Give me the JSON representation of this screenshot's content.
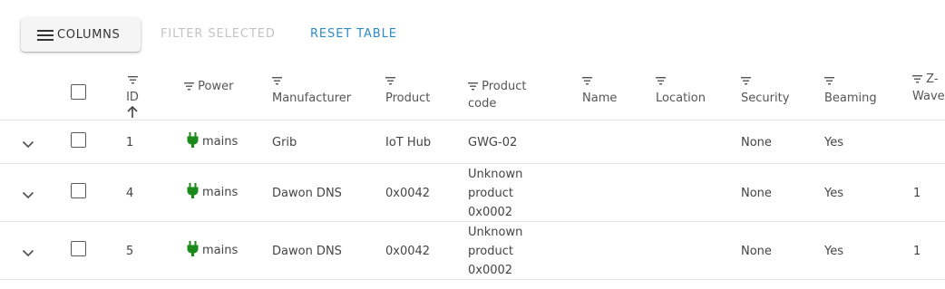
{
  "toolbar": {
    "columns_label": "COLUMNS",
    "filter_selected_label": "FILTER SELECTED",
    "reset_table_label": "RESET TABLE"
  },
  "columns": {
    "id": "ID",
    "power": "Power",
    "manufacturer": "Manufacturer",
    "product": "Product",
    "product_code_line1": "Product",
    "product_code_line2": "code",
    "name": "Name",
    "location": "Location",
    "security": "Security",
    "beaming": "Beaming",
    "zwave_line1": "Z-",
    "zwave_line2": "Wave+"
  },
  "sort": {
    "column": "ID",
    "direction": "ascending"
  },
  "colors": {
    "accent": "#2e8bc9",
    "power_icon": "#1b8a1b",
    "disabled": "#c3c3c3"
  },
  "rows": [
    {
      "id": "1",
      "power": "mains",
      "manufacturer": "Grib",
      "product": "IoT Hub",
      "product_code": [
        "GWG-02"
      ],
      "name": "",
      "location": "",
      "security": "None",
      "beaming": "Yes",
      "zwave": ""
    },
    {
      "id": "4",
      "power": "mains",
      "manufacturer": "Dawon DNS",
      "product": "0x0042",
      "product_code": [
        "Unknown",
        "product",
        "0x0002"
      ],
      "name": "",
      "location": "",
      "security": "None",
      "beaming": "Yes",
      "zwave": "1"
    },
    {
      "id": "5",
      "power": "mains",
      "manufacturer": "Dawon DNS",
      "product": "0x0042",
      "product_code": [
        "Unknown",
        "product",
        "0x0002"
      ],
      "name": "",
      "location": "",
      "security": "None",
      "beaming": "Yes",
      "zwave": "1"
    }
  ]
}
